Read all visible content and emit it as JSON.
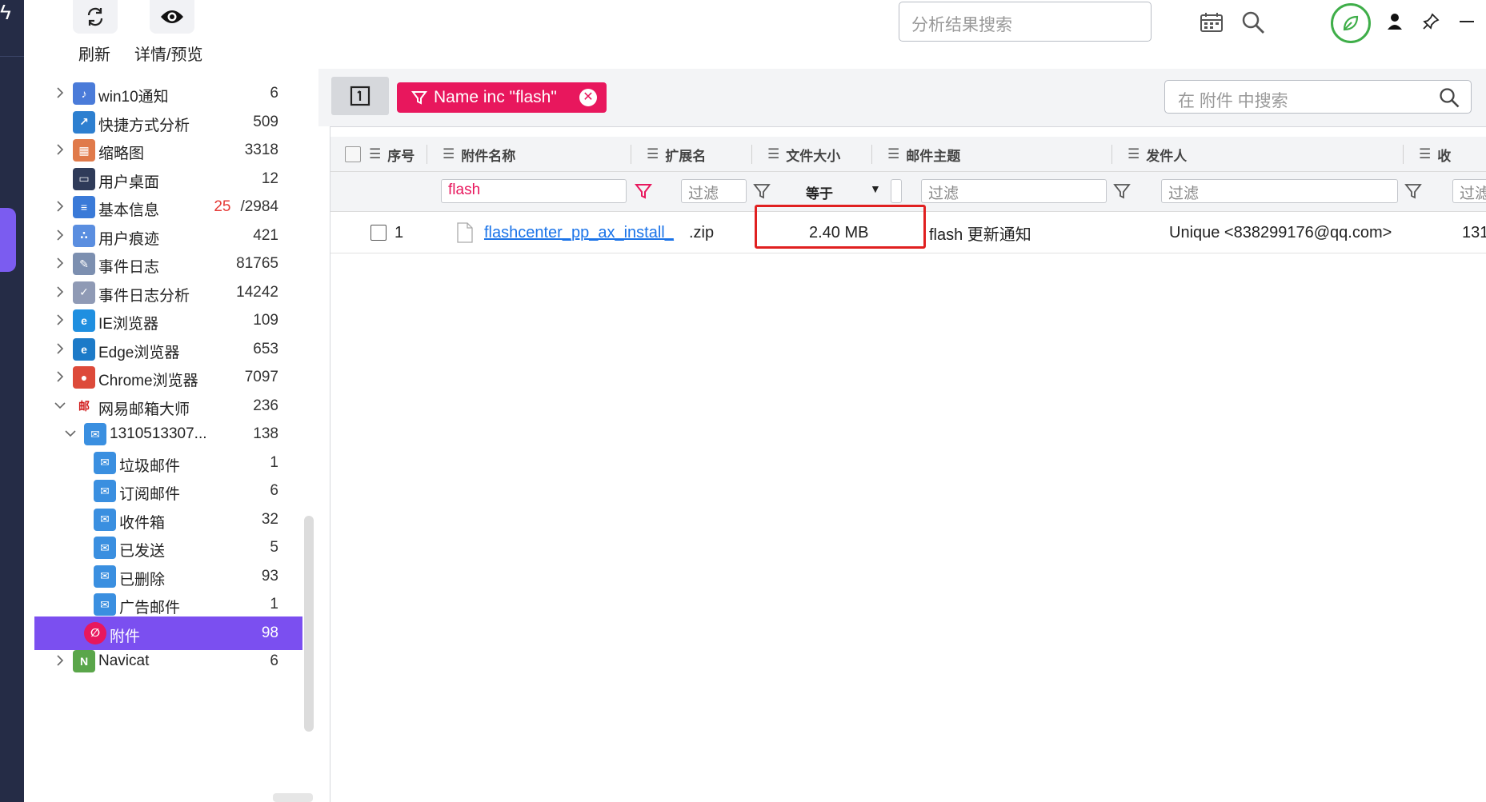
{
  "toolbar": {
    "refresh_label": "刷新",
    "preview_label": "详情/预览",
    "search_placeholder": "分析结果搜索"
  },
  "tree": [
    {
      "label": "win10通知",
      "count": "6",
      "icon": "notification-bell-icon",
      "expandable": true
    },
    {
      "label": "快捷方式分析",
      "count": "509",
      "icon": "shortcut-icon",
      "expandable": false
    },
    {
      "label": "缩略图",
      "count": "3318",
      "icon": "thumbnail-grid-icon",
      "expandable": true
    },
    {
      "label": "用户桌面",
      "count": "12",
      "icon": "desktop-monitor-icon",
      "expandable": false
    },
    {
      "label": "基本信息",
      "count_red": "25",
      "count": "/2984",
      "icon": "info-list-icon",
      "expandable": true
    },
    {
      "label": "用户痕迹",
      "count": "421",
      "icon": "footprints-icon",
      "expandable": true
    },
    {
      "label": "事件日志",
      "count": "81765",
      "icon": "event-log-icon",
      "expandable": true
    },
    {
      "label": "事件日志分析",
      "count": "14242",
      "icon": "log-analysis-icon",
      "expandable": true
    },
    {
      "label": "IE浏览器",
      "count": "109",
      "icon": "ie-browser-icon",
      "expandable": true
    },
    {
      "label": "Edge浏览器",
      "count": "653",
      "icon": "edge-browser-icon",
      "expandable": true
    },
    {
      "label": "Chrome浏览器",
      "count": "7097",
      "icon": "chrome-browser-icon",
      "expandable": true
    },
    {
      "label": "网易邮箱大师",
      "count": "236",
      "icon": "netease-mail-icon",
      "expandable": true,
      "expanded": true
    },
    {
      "label": "1310513307...",
      "count": "138",
      "icon": "mail-envelope-icon",
      "expandable": true,
      "expanded": true,
      "level": 1
    },
    {
      "label": "垃圾邮件",
      "count": "1",
      "icon": "mail-envelope-icon",
      "level": 2
    },
    {
      "label": "订阅邮件",
      "count": "6",
      "icon": "mail-envelope-icon",
      "level": 2
    },
    {
      "label": "收件箱",
      "count": "32",
      "icon": "mail-envelope-icon",
      "level": 2
    },
    {
      "label": "已发送",
      "count": "5",
      "icon": "mail-envelope-icon",
      "level": 2
    },
    {
      "label": "已删除",
      "count": "93",
      "icon": "mail-envelope-icon",
      "level": 2
    },
    {
      "label": "广告邮件",
      "count": "1",
      "icon": "mail-envelope-icon",
      "level": 2
    },
    {
      "label": "附件",
      "count": "98",
      "icon": "attachment-icon",
      "level": 1,
      "selected": true
    },
    {
      "label": "Navicat",
      "count": "6",
      "icon": "navicat-icon",
      "expandable": true
    }
  ],
  "filter_chip": {
    "text": "Name inc \"flash\""
  },
  "grid_search": {
    "placeholder": "在 附件 中搜索"
  },
  "columns": {
    "index": "序号",
    "name": "附件名称",
    "ext": "扩展名",
    "size": "文件大小",
    "subject": "邮件主题",
    "sender": "发件人",
    "recipient": "收"
  },
  "filters": {
    "name_value": "flash",
    "placeholder": "过滤",
    "size_operator": "等于"
  },
  "rows": [
    {
      "index": "1",
      "name": "flashcenter_pp_ax_install_",
      "ext": ".zip",
      "size": "2.40 MB",
      "subject": "flash 更新通知",
      "sender": "Unique <838299176@qq.com>",
      "recipient": "131"
    }
  ],
  "colors": {
    "accent_purple": "#7b4ff0",
    "chip_pink": "#e8175d",
    "highlight_red": "#e02020",
    "link_blue": "#1a73e8",
    "rail_dark": "#252c46",
    "leaf_green": "#3fae49"
  }
}
